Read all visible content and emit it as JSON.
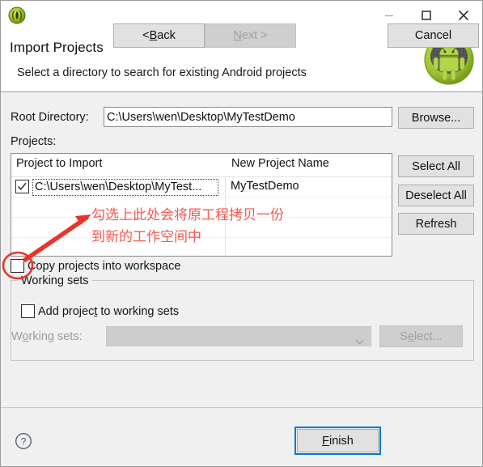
{
  "window": {
    "app_icon": "eclipse-icon",
    "minimize_label": "minimize-icon",
    "maximize_label": "maximize-icon",
    "close_label": "close-icon"
  },
  "header": {
    "title": "Import Projects",
    "subtitle": "Select a directory to search for existing Android projects",
    "logo": "android-robot-icon"
  },
  "form": {
    "root_directory_label": "Root Directory:",
    "root_directory_value": "C:\\Users\\wen\\Desktop\\MyTestDemo",
    "root_directory_placeholder": "",
    "browse_label": "Browse...",
    "projects_label": "Projects:"
  },
  "table": {
    "columns": [
      "Project to Import",
      "New Project Name"
    ],
    "rows": [
      {
        "checked": true,
        "project_to_import": "C:\\Users\\wen\\Desktop\\MyTest...",
        "new_project_name": "MyTestDemo"
      }
    ],
    "empty_rows": 4
  },
  "side_buttons": {
    "select_all": "Select All",
    "deselect_all": "Deselect All",
    "refresh": "Refresh"
  },
  "copy_option": {
    "label": "Copy projects into workspace",
    "checked": false
  },
  "working_sets": {
    "group_title": "Working sets",
    "add_project_label_before": "Add projec",
    "add_project_label_accel": "t",
    "add_project_label_after": " to working sets",
    "add_project_checked": false,
    "combo_label_before": "W",
    "combo_label_accel": "o",
    "combo_label_after": "rking sets:",
    "combo_value": "",
    "select_label_before": "S",
    "select_label_accel": "e",
    "select_label_after": "lect...",
    "select_disabled": true
  },
  "footer": {
    "help": "help-icon",
    "back_before": "< ",
    "back_accel": "B",
    "back_after": "ack",
    "next_before": "",
    "next_accel": "N",
    "next_after": "ext >",
    "next_disabled": true,
    "finish_accel": "F",
    "finish_after": "inish",
    "cancel": "Cancel"
  },
  "annotations": {
    "note_text": "勾选上此处会将原工程拷贝一份\n到新的工作空间中",
    "color": "#f4584f",
    "circle_target": "copy-projects-checkbox"
  },
  "colors": {
    "accent_blue": "#0078d7",
    "dialog_bg": "#f0f0f0",
    "annotation_red": "#f4584f",
    "android_green": "#a4c739"
  }
}
